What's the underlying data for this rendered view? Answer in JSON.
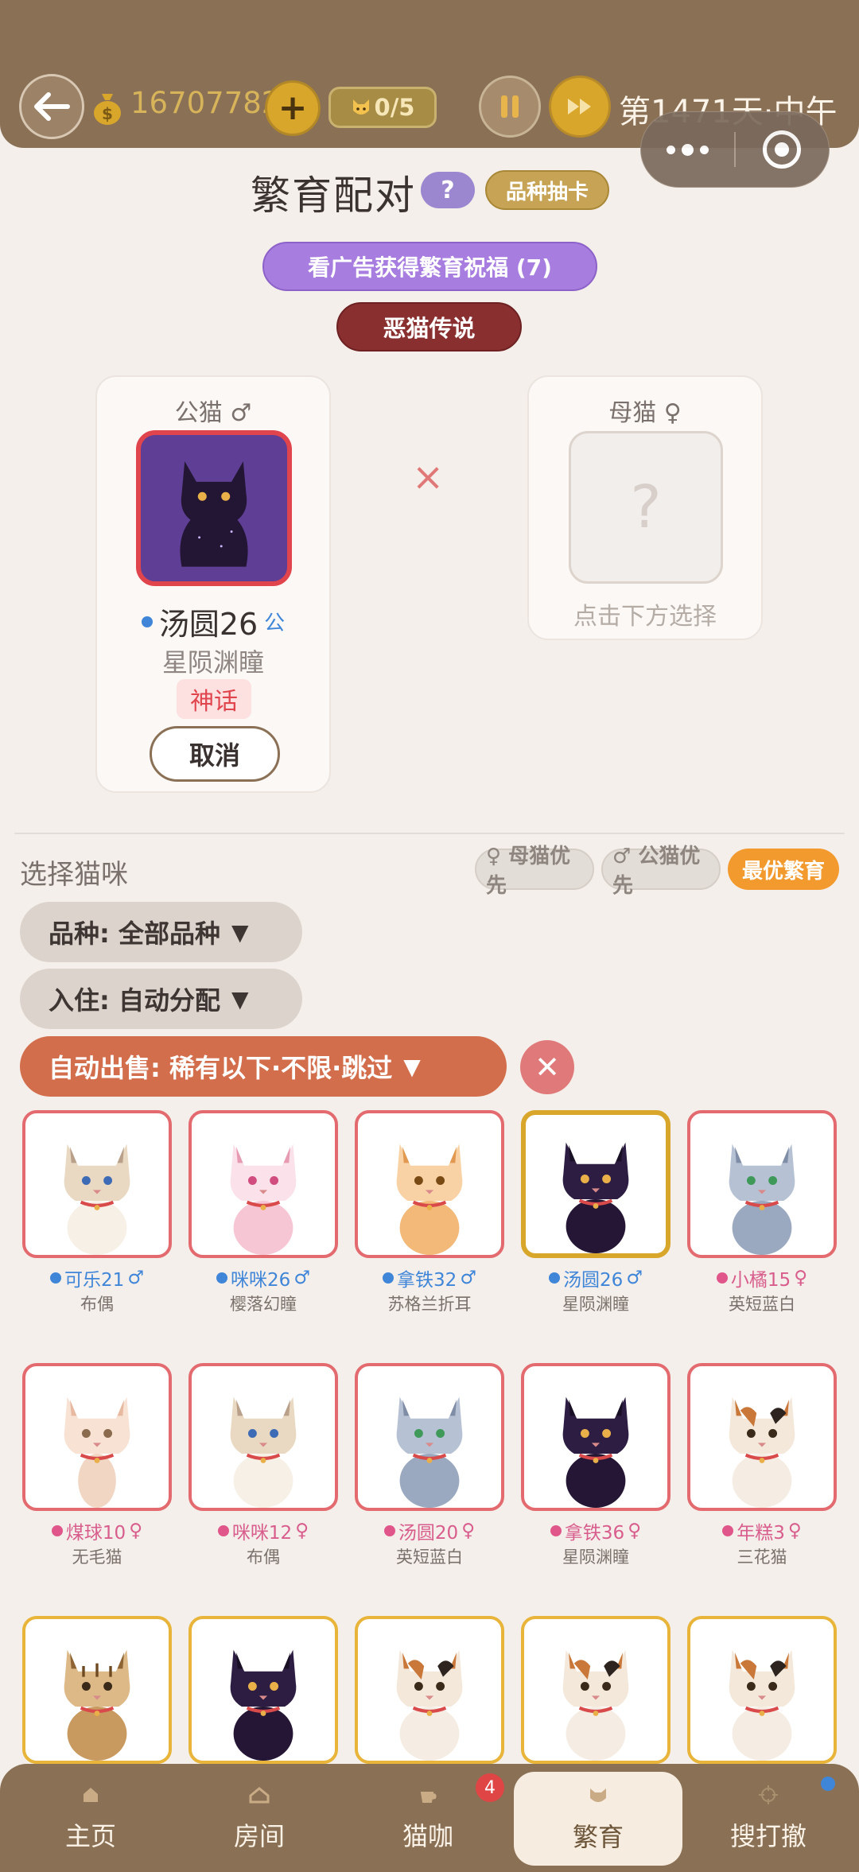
{
  "topbar": {
    "coins": "16707782",
    "capacity": "0/5",
    "day": "第1471天·中午"
  },
  "header": {
    "title": "繁育配对",
    "help_label": "?",
    "gacha_label": "品种抽卡",
    "ad_label": "看广告获得繁育祝福 (7)",
    "legend_label": "恶猫传说"
  },
  "pair": {
    "male_head": "公猫 ♂",
    "female_head": "母猫 ♀",
    "times": "×",
    "male": {
      "name": "汤圆26",
      "gender": "公",
      "breed": "星陨渊瞳",
      "rarity": "神话",
      "cancel_label": "取消"
    },
    "female_empty_mark": "?",
    "female_hint": "点击下方选择"
  },
  "select": {
    "label": "选择猫咪",
    "chip_female": "♀ 母猫优先",
    "chip_male": "♂ 公猫优先",
    "chip_best": "最优繁育",
    "breed_filter": "品种: 全部品种",
    "house_filter": "入住: 自动分配",
    "auto_sell": "自动出售: 稀有以下·不限·跳过",
    "arrow": "▼",
    "clear": "✕"
  },
  "cats": [
    {
      "name": "可乐21",
      "sex": "♂",
      "breed": "布偶",
      "color": "blue",
      "kind": "ragdoll",
      "frame": "red"
    },
    {
      "name": "咪咪26",
      "sex": "♂",
      "breed": "樱落幻瞳",
      "color": "blue",
      "kind": "pink",
      "frame": "red"
    },
    {
      "name": "拿铁32",
      "sex": "♂",
      "breed": "苏格兰折耳",
      "color": "blue",
      "kind": "orange",
      "frame": "red"
    },
    {
      "name": "汤圆26",
      "sex": "♂",
      "breed": "星陨渊瞳",
      "color": "blue",
      "kind": "black",
      "frame": "selected"
    },
    {
      "name": "小橘15",
      "sex": "♀",
      "breed": "英短蓝白",
      "color": "pink",
      "kind": "gray",
      "frame": "red"
    },
    {
      "name": "煤球10",
      "sex": "♀",
      "breed": "无毛猫",
      "color": "pink",
      "kind": "sphynx",
      "frame": "red"
    },
    {
      "name": "咪咪12",
      "sex": "♀",
      "breed": "布偶",
      "color": "pink",
      "kind": "ragdoll",
      "frame": "red"
    },
    {
      "name": "汤圆20",
      "sex": "♀",
      "breed": "英短蓝白",
      "color": "pink",
      "kind": "gray",
      "frame": "red"
    },
    {
      "name": "拿铁36",
      "sex": "♀",
      "breed": "星陨渊瞳",
      "color": "pink",
      "kind": "black",
      "frame": "red"
    },
    {
      "name": "年糕3",
      "sex": "♀",
      "breed": "三花猫",
      "color": "pink",
      "kind": "calico",
      "frame": "red"
    },
    {
      "name": "",
      "sex": "",
      "breed": "",
      "color": "blue",
      "kind": "tabby",
      "frame": "gold"
    },
    {
      "name": "",
      "sex": "",
      "breed": "",
      "color": "blue",
      "kind": "black",
      "frame": "gold"
    },
    {
      "name": "",
      "sex": "",
      "breed": "",
      "color": "blue",
      "kind": "calico",
      "frame": "gold"
    },
    {
      "name": "",
      "sex": "",
      "breed": "",
      "color": "blue",
      "kind": "calico",
      "frame": "gold"
    },
    {
      "name": "",
      "sex": "",
      "breed": "",
      "color": "blue",
      "kind": "calico",
      "frame": "gold"
    }
  ],
  "nav": {
    "home": "主页",
    "room": "房间",
    "cafe": "猫咖",
    "breed": "繁育",
    "scout": "搜打撤",
    "cafe_badge": "4"
  },
  "colors": {
    "brown": "#8a7055",
    "gold": "#d9a62c",
    "purple": "#a77de0",
    "maroon": "#8a2f30",
    "red_frame": "#e36b6f",
    "orange": "#f29a2e",
    "sell": "#d36e4c"
  }
}
